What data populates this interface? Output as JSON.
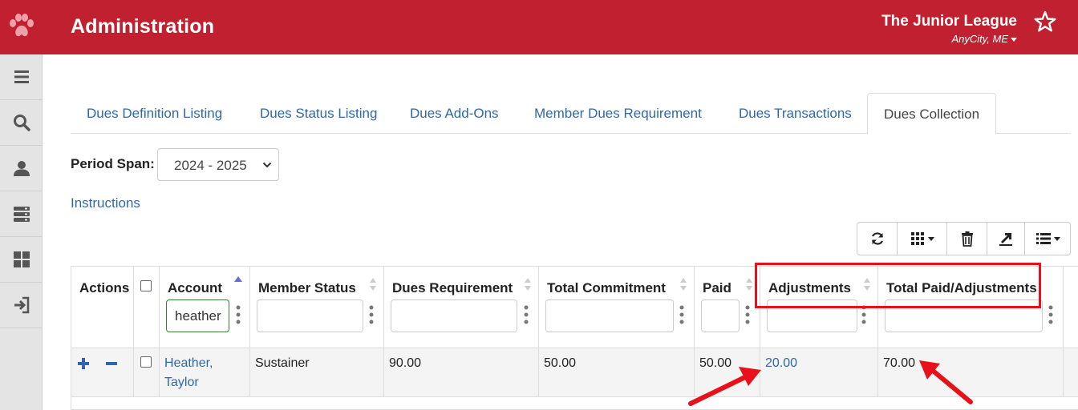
{
  "header": {
    "title": "Administration",
    "org_name": "The Junior League",
    "org_city": "AnyCity, ME",
    "bar_color": "#c0202f"
  },
  "sidebar": {
    "items": [
      {
        "icon": "menu-icon"
      },
      {
        "icon": "search-icon"
      },
      {
        "icon": "user-icon"
      },
      {
        "icon": "server-icon"
      },
      {
        "icon": "dashboard-icon"
      },
      {
        "icon": "sign-in-icon"
      }
    ]
  },
  "tabs": [
    {
      "label": "Dues Definition Listing"
    },
    {
      "label": "Dues Status Listing"
    },
    {
      "label": "Dues Add-Ons"
    },
    {
      "label": "Member Dues Requirement"
    },
    {
      "label": "Dues Transactions"
    },
    {
      "label": "Dues Collection",
      "active": true
    }
  ],
  "period": {
    "label": "Period Span:",
    "value": "2024 - 2025"
  },
  "instructions_link": "Instructions",
  "toolbar": [
    "refresh-icon",
    "columns-icon",
    "trash-icon",
    "export-icon",
    "list-icon"
  ],
  "table": {
    "headers": {
      "actions": "Actions",
      "account": "Account",
      "member_status": "Member Status",
      "dues_requirement": "Dues Requirement",
      "total_commitment": "Total Commitment",
      "paid": "Paid",
      "adjustments": "Adjustments",
      "total_paid_adjustments": "Total Paid/Adjustments"
    },
    "filters": {
      "account": "heather"
    },
    "rows": [
      {
        "account_line1": "Heather,",
        "account_line2": "Taylor",
        "member_status": "Sustainer",
        "dues_requirement": "90.00",
        "total_commitment": "50.00",
        "paid": "50.00",
        "adjustments": "20.00",
        "total_paid_adjustments": "70.00"
      }
    ]
  },
  "annotation_color": "#e8101a"
}
